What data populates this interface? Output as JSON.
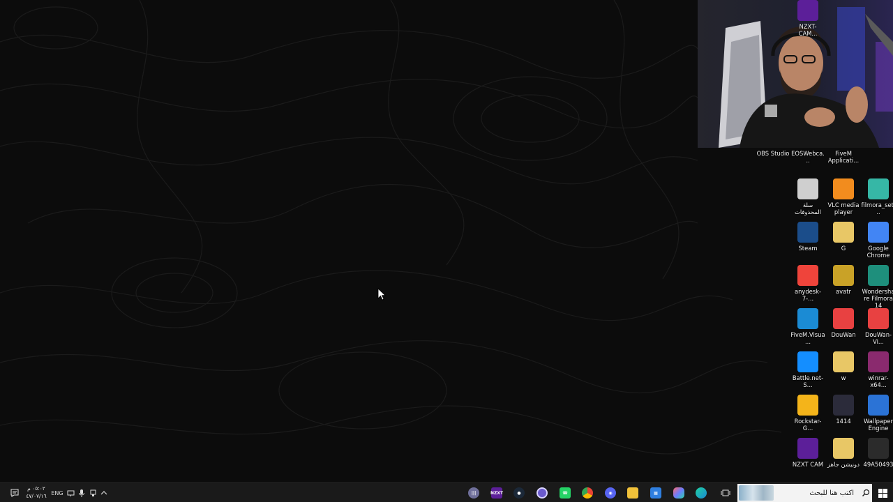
{
  "desktop": {
    "icons": [
      {
        "label": "OBS Studio",
        "icon": "obs-icon",
        "color": "#3a3a3a"
      },
      {
        "label": "EOSWebca...",
        "icon": "eos-webcam-icon",
        "color": "#3a6e3a"
      },
      {
        "label": "FiveM Applicati...",
        "icon": "fivem-icon",
        "color": "#f08a24"
      },
      {
        "label": "سلة المحذوفات",
        "icon": "recycle-bin-icon",
        "color": "#cfcfcf"
      },
      {
        "label": "VLC media player",
        "icon": "vlc-icon",
        "color": "#f28c1e"
      },
      {
        "label": "filmora_set...",
        "icon": "filmora-setup-icon",
        "color": "#36b7a6"
      },
      {
        "label": "Steam",
        "icon": "steam-icon",
        "color": "#1b4d8a"
      },
      {
        "label": "G",
        "icon": "folder-zip-icon",
        "color": "#e8c766"
      },
      {
        "label": "Google Chrome",
        "icon": "chrome-icon",
        "color": "#4285f4"
      },
      {
        "label": "anydesk-7-...",
        "icon": "anydesk-icon",
        "color": "#ef443b"
      },
      {
        "label": "avatr",
        "icon": "avatr-icon",
        "color": "#c9a227"
      },
      {
        "label": "Wondershare Filmora 14",
        "icon": "filmora-icon",
        "color": "#1e8f7c"
      },
      {
        "label": "FiveM.Visua...",
        "icon": "edge-icon",
        "color": "#1b8bd4"
      },
      {
        "label": "DouWan",
        "icon": "douwan-icon",
        "color": "#e84141"
      },
      {
        "label": "DouWan-Vi...",
        "icon": "douwan-installer-icon",
        "color": "#e84141"
      },
      {
        "label": "Battle.net-S...",
        "icon": "battlenet-icon",
        "color": "#148eff"
      },
      {
        "label": "w",
        "icon": "folder-image-icon",
        "color": "#e8c766"
      },
      {
        "label": "winrar-x64...",
        "icon": "winrar-icon",
        "color": "#8a2a6e"
      },
      {
        "label": "Rockstar-G...",
        "icon": "rockstar-icon",
        "color": "#f4b41a"
      },
      {
        "label": "1414",
        "icon": "image-file-icon",
        "color": "#2b2b3a"
      },
      {
        "label": "Wallpaper Engine",
        "icon": "wallpaper-engine-icon",
        "color": "#2b73d6"
      },
      {
        "label": "NZXT CAM",
        "icon": "nzxt-cam-icon",
        "color": "#5c1f99"
      },
      {
        "label": "دونيشن جاهز",
        "icon": "folder-video-icon",
        "color": "#e8c766"
      },
      {
        "label": "49A50493",
        "icon": "image-file-icon",
        "color": "#2b2b2b"
      },
      {
        "label": "NZXT-CAM...",
        "icon": "nzxt-cam-installer-icon",
        "color": "#5c1f99"
      }
    ],
    "nzxt_badge": "NZXT"
  },
  "taskbar": {
    "search_placeholder": "اكتب هنا للبحث",
    "clock_time": "٠٥:٠٢ م",
    "clock_date": "٤٧/٠٧/١٦",
    "lang": "ENG",
    "pinned": [
      {
        "icon": "task-view-icon",
        "color": "#cfcfcf"
      },
      {
        "icon": "edge-icon",
        "color": "#1b8bd4"
      },
      {
        "icon": "copilot-icon",
        "color": "#6b7cff"
      },
      {
        "icon": "store-icon",
        "color": "#2f7fe0"
      },
      {
        "icon": "file-explorer-icon",
        "color": "#f2c23a"
      },
      {
        "icon": "discord-icon",
        "color": "#5865f2"
      },
      {
        "icon": "chrome-icon",
        "color": "#4285f4"
      },
      {
        "icon": "whatsapp-icon",
        "color": "#25d366"
      },
      {
        "icon": "obs-icon",
        "color": "#6a5acd"
      },
      {
        "icon": "steam-icon",
        "color": "#1b4d8a"
      },
      {
        "icon": "nzxt-icon",
        "color": "#5c1f99"
      },
      {
        "icon": "wave-app-icon",
        "color": "#6f6f9a"
      }
    ]
  }
}
